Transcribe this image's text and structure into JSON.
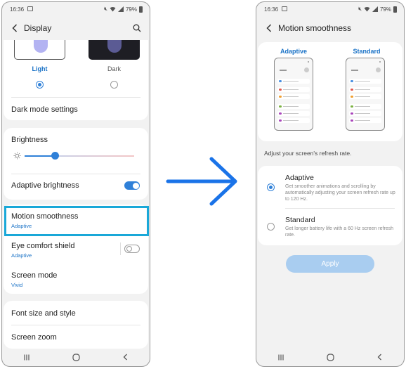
{
  "colors": {
    "accent": "#2f80d8",
    "link_blue": "#1b73c7",
    "highlight": "#1aa8d8",
    "arrow": "#1a73e8",
    "apply_disabled": "#a9cdf0",
    "screen_bg": "#f2f2f2"
  },
  "display_screen": {
    "status_time": "16:36",
    "battery": "79%",
    "title": "Display",
    "theme": {
      "options": [
        "Light",
        "Dark"
      ],
      "selected": "Light"
    },
    "dark_mode_settings": "Dark mode settings",
    "brightness": {
      "label": "Brightness",
      "level": 0.26
    },
    "adaptive_brightness": {
      "label": "Adaptive brightness",
      "enabled": true
    },
    "motion_smoothness": {
      "label": "Motion smoothness",
      "value": "Adaptive"
    },
    "eye_comfort_shield": {
      "label": "Eye comfort shield",
      "value": "Adaptive",
      "enabled": false
    },
    "screen_mode": {
      "label": "Screen mode",
      "value": "Vivid"
    },
    "font_size_and_style": "Font size and style",
    "screen_zoom": "Screen zoom"
  },
  "motion_screen": {
    "status_time": "16:36",
    "battery": "79%",
    "title": "Motion smoothness",
    "preview_labels": [
      "Adaptive",
      "Standard"
    ],
    "hint": "Adjust your screen's refresh rate.",
    "options": [
      {
        "title": "Adaptive",
        "desc": "Get smoother animations and scrolling by automatically adjusting your screen refresh rate up to 120 Hz.",
        "selected": true
      },
      {
        "title": "Standard",
        "desc": "Get longer battery life with a 60 Hz screen refresh rate.",
        "selected": false
      }
    ],
    "apply_label": "Apply"
  },
  "icons": {
    "back": "back-arrow-icon",
    "search": "search-icon",
    "brightness": "sun-icon",
    "navigation": [
      "recents-icon",
      "home-icon",
      "back-nav-icon"
    ],
    "transition": "right-arrow-icon"
  }
}
